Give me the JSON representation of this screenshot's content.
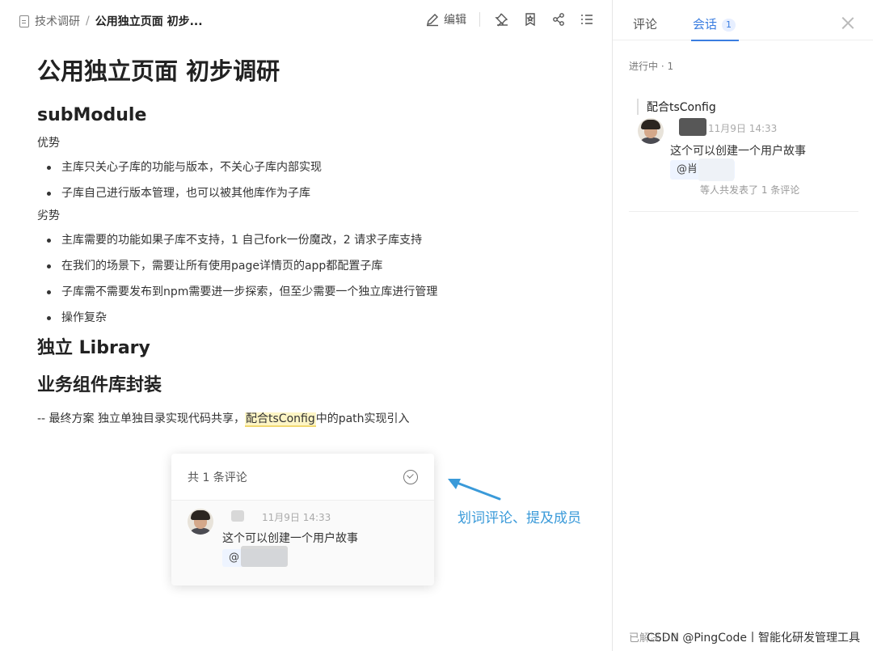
{
  "breadcrumb": {
    "parent": "技术调研",
    "separator": "/",
    "current": "公用独立页面 初步..."
  },
  "toolbar": {
    "edit_label": "编辑"
  },
  "doc": {
    "title": "公用独立页面 初步调研",
    "section1": "subModule",
    "pros_label": "优势",
    "pros": [
      "主库只关心子库的功能与版本，不关心子库内部实现",
      "子库自己进行版本管理，也可以被其他库作为子库"
    ],
    "cons_label": "劣势",
    "cons": [
      "主库需要的功能如果子库不支持，1 自己fork一份魔改，2 请求子库支持",
      "在我们的场景下，需要让所有使用page详情页的app都配置子库",
      "子库需不需要发布到npm需要进一步探索，但至少需要一个独立库进行管理",
      "操作复杂"
    ],
    "section2": "独立 Library",
    "section3": "业务组件库封装",
    "final_prefix": "-- 最终方案  独立单独目录实现代码共享，",
    "final_highlight": "配合tsConfig",
    "final_suffix": "中的path实现引入"
  },
  "popover": {
    "title": "共 1 条评论",
    "time": "11月9日 14:33",
    "text": "这个可以创建一个用户故事",
    "mention": "@"
  },
  "annotation": {
    "text": "划词评论、提及成员",
    "color": "#3a9ad9"
  },
  "panel": {
    "tabs": {
      "comments": "评论",
      "sessions": "会话",
      "sessions_count": "1"
    },
    "status": "进行中 · 1",
    "thread": {
      "quote": "配合tsConfig",
      "time": "11月9日 14:33",
      "text": "这个可以创建一个用户故事",
      "mention": "@肖",
      "count_text": "等人共发表了 1 条评论"
    },
    "resolved_label": "已解决 · 0",
    "watermark": "CSDN @PingCode丨智能化研发管理工具"
  },
  "colors": {
    "accent": "#3a7de0",
    "highlight": "#fdf5c5",
    "annotation": "#3a9ad9"
  }
}
